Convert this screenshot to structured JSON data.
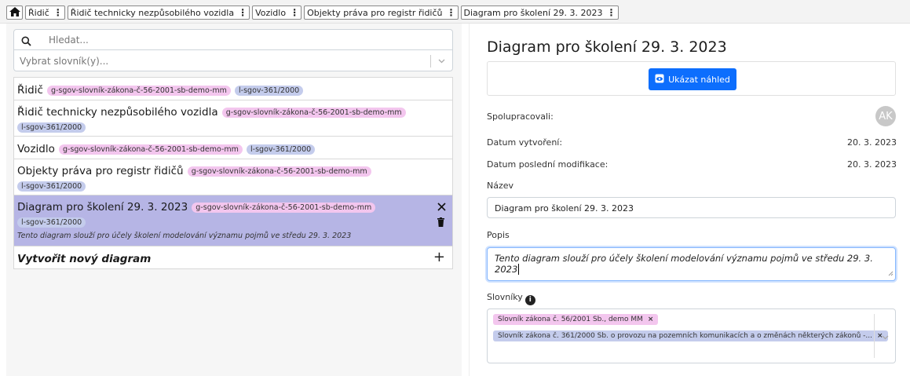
{
  "tabs": [
    {
      "label": "Řidič"
    },
    {
      "label": "Řidič technicky nezpůsobilého vozidla"
    },
    {
      "label": "Vozidlo"
    },
    {
      "label": "Objekty práva pro registr řidičů"
    },
    {
      "label": "Diagram pro školení 29. 3. 2023"
    }
  ],
  "search": {
    "placeholder": "Hledat..."
  },
  "vocab_select": {
    "placeholder": "Vybrat slovník(y)..."
  },
  "list": {
    "items": [
      {
        "name": "Řidič",
        "tags": [
          "g-sgov-slovník-zákona-č-56-2001-sb-demo-mm",
          "l-sgov-361/2000"
        ]
      },
      {
        "name": "Řidič technicky nezpůsobilého vozidla",
        "tags": [
          "g-sgov-slovník-zákona-č-56-2001-sb-demo-mm",
          "l-sgov-361/2000"
        ]
      },
      {
        "name": "Vozidlo",
        "tags": [
          "g-sgov-slovník-zákona-č-56-2001-sb-demo-mm",
          "l-sgov-361/2000"
        ]
      },
      {
        "name": "Objekty práva pro registr řidičů",
        "tags": [
          "g-sgov-slovník-zákona-č-56-2001-sb-demo-mm",
          "l-sgov-361/2000"
        ]
      },
      {
        "name": "Diagram pro školení 29. 3. 2023",
        "tags": [
          "g-sgov-slovník-zákona-č-56-2001-sb-demo-mm",
          "l-sgov-361/2000"
        ],
        "description": "Tento diagram slouží pro účely školení modelování významu pojmů ve středu 29. 3. 2023"
      }
    ],
    "new_label": "Vytvořit nový diagram"
  },
  "detail": {
    "title": "Diagram pro školení 29. 3. 2023",
    "preview_label": "Ukázat náhled",
    "collaborators_label": "Spolupracovali:",
    "avatar_initials": "AK",
    "created_label": "Datum vytvoření:",
    "created_value": "20. 3. 2023",
    "modified_label": "Datum poslední modifikace:",
    "modified_value": "20. 3. 2023",
    "name_label": "Název",
    "name_value": "Diagram pro školení 29. 3. 2023",
    "desc_label": "Popis",
    "desc_value": "Tento diagram slouží pro účely školení modelování významu pojmů ve středu 29. 3. 2023",
    "vocabs_label": "Slovníky",
    "vocabs": [
      "Slovník zákona č. 56/2001 Sb., demo MM",
      "Slovník zákona č. 361/2000 Sb. o provozu na pozemních komunikacích a o změnách některých zákonů -..."
    ]
  },
  "colors": {
    "accent": "#0d6efd",
    "selected": "#b6b5e5",
    "tag_pink": "#f3c6ee",
    "tag_blue": "#c4ccec"
  }
}
